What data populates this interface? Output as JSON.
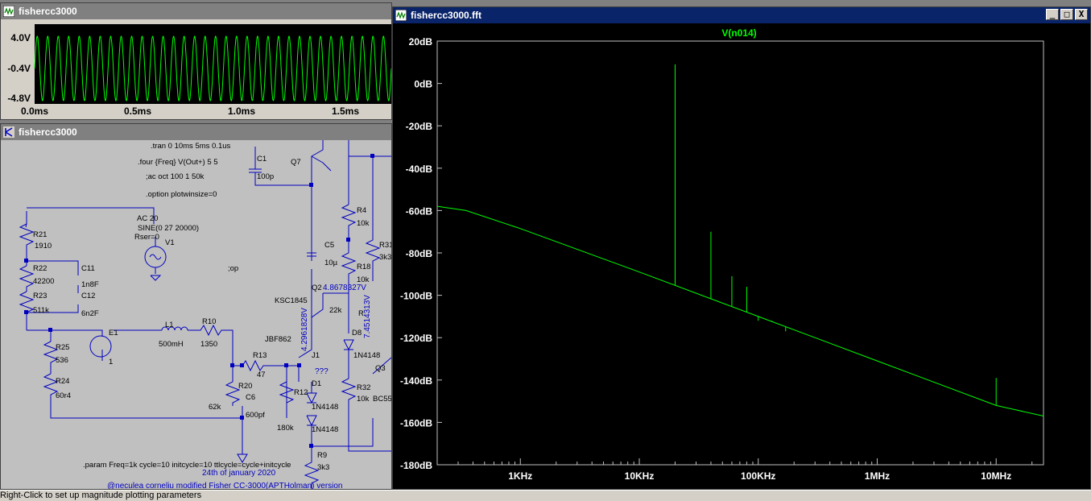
{
  "waveform_window": {
    "title": "fishercc3000",
    "y_ticks": [
      "4.0V",
      "-0.4V",
      "-4.8V"
    ],
    "x_ticks": [
      "0.0ms",
      "0.5ms",
      "1.0ms",
      "1.5ms"
    ]
  },
  "schematic_window": {
    "title": "fishercc3000",
    "directives": [
      ".tran 0 10ms 5ms 0.1us",
      ".four {Freq} V(Out+) 5 5",
      ";ac oct 100 1 50k",
      ".option plotwinsize=0",
      ";op",
      ".param Freq=1k cycle=10 initcycle=10 ttlcycle=cycle+initcycle"
    ],
    "source": {
      "type": "AC 20",
      "params": "SINE(0 27 20000)",
      "rser": "Rser=0",
      "name": "V1"
    },
    "components": [
      {
        "ref": "R21",
        "value": "1910"
      },
      {
        "ref": "R22",
        "value": "42200"
      },
      {
        "ref": "R23",
        "value": "511k"
      },
      {
        "ref": "C11",
        "value": "1n8F"
      },
      {
        "ref": "C12",
        "value": "6n2F"
      },
      {
        "ref": "R25",
        "value": "536"
      },
      {
        "ref": "R24",
        "value": "60r4"
      },
      {
        "ref": "E1",
        "value": "1"
      },
      {
        "ref": "L1",
        "value": "500mH"
      },
      {
        "ref": "R10",
        "value": "1350"
      },
      {
        "ref": "R13",
        "value": "47"
      },
      {
        "ref": "R20",
        "value": "62k"
      },
      {
        "ref": "C6",
        "value": "600pf"
      },
      {
        "ref": "R12",
        "value": "180k"
      },
      {
        "ref": "C1",
        "value": "100p"
      },
      {
        "ref": "Q7",
        "value": ""
      },
      {
        "ref": "C5",
        "value": "10µ"
      },
      {
        "ref": "R4",
        "value": "10k"
      },
      {
        "ref": "R18",
        "value": "10k"
      },
      {
        "ref": "R31",
        "value": "3k3"
      },
      {
        "ref": "Q2",
        "value": "KSC1845"
      },
      {
        "ref": "J1",
        "value": "JBF862"
      },
      {
        "ref": "D1",
        "value": "1N4148"
      },
      {
        "ref": "D8",
        "value": "1N4148"
      },
      {
        "ref": "R32",
        "value": "10k"
      },
      {
        "ref": "R9",
        "value": "3k3"
      },
      {
        "ref": "Q3",
        "value": "BC55"
      }
    ],
    "probe_voltages": [
      "4.8678327V",
      "4.2961828V",
      "7.4514313V"
    ],
    "unknown": "???",
    "r_partial": "22k",
    "date": "24th of january 2020",
    "credit": "@neculea corneliu modified Fisher CC-3000(APTHolman) version"
  },
  "fft_window": {
    "title": "fishercc3000.fft",
    "controls": [
      "_",
      "□",
      "X"
    ],
    "trace_label": "V(n014)",
    "trace_color": "#00ff00",
    "background_color": "#000000"
  },
  "chart_data": {
    "type": "line",
    "title": "V(n014)",
    "xlabel": "",
    "ylabel": "",
    "x_scale": "log",
    "xlim": [
      200,
      25000000
    ],
    "ylim": [
      -180,
      20
    ],
    "x_ticks": [
      "1KHz",
      "10KHz",
      "100KHz",
      "1MHz",
      "10MHz"
    ],
    "y_ticks": [
      "20dB",
      "0dB",
      "-20dB",
      "-40dB",
      "-60dB",
      "-80dB",
      "-100dB",
      "-120dB",
      "-140dB",
      "-160dB",
      "-180dB"
    ],
    "noise_floor": [
      {
        "x": 200,
        "y": -58
      },
      {
        "x": 350,
        "y": -60
      },
      {
        "x": 1000,
        "y": -68.5
      },
      {
        "x": 10000,
        "y": -89
      },
      {
        "x": 100000,
        "y": -110
      },
      {
        "x": 1000000,
        "y": -131
      },
      {
        "x": 10000000,
        "y": -152
      },
      {
        "x": 25000000,
        "y": -157
      }
    ],
    "spikes": [
      {
        "x": 20000,
        "y": 9
      },
      {
        "x": 40000,
        "y": -70
      },
      {
        "x": 60000,
        "y": -91
      },
      {
        "x": 80000,
        "y": -96
      },
      {
        "x": 100000,
        "y": -112
      },
      {
        "x": 130000,
        "y": -112
      },
      {
        "x": 170000,
        "y": -117
      },
      {
        "x": 10000000,
        "y": -139
      }
    ]
  },
  "status_bar": {
    "text": "Right-Click to set up magnitude plotting parameters"
  }
}
